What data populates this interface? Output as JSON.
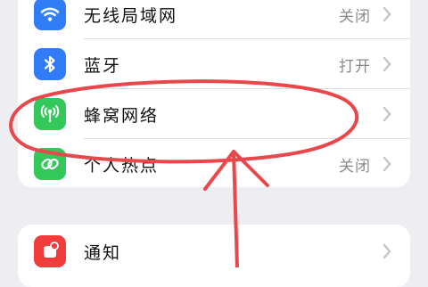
{
  "settings": {
    "connectivity": [
      {
        "label": "无线局域网",
        "value": "关闭",
        "icon": "wifi-icon",
        "color": "#2f7cf6"
      },
      {
        "label": "蓝牙",
        "value": "打开",
        "icon": "bluetooth-icon",
        "color": "#2f7cf6"
      },
      {
        "label": "蜂窝网络",
        "value": "",
        "icon": "cellular-antenna-icon",
        "color": "#34c759"
      },
      {
        "label": "个人热点",
        "value": "关闭",
        "icon": "hotspot-chain-icon",
        "color": "#34c759"
      }
    ],
    "notifications": [
      {
        "label": "通知",
        "value": "",
        "icon": "notification-bell-icon",
        "color": "#f23b3b"
      }
    ]
  },
  "annotation": {
    "color": "#e8474c",
    "marks": [
      "red-ellipse-highlight",
      "red-arrow-pointing-up"
    ]
  }
}
